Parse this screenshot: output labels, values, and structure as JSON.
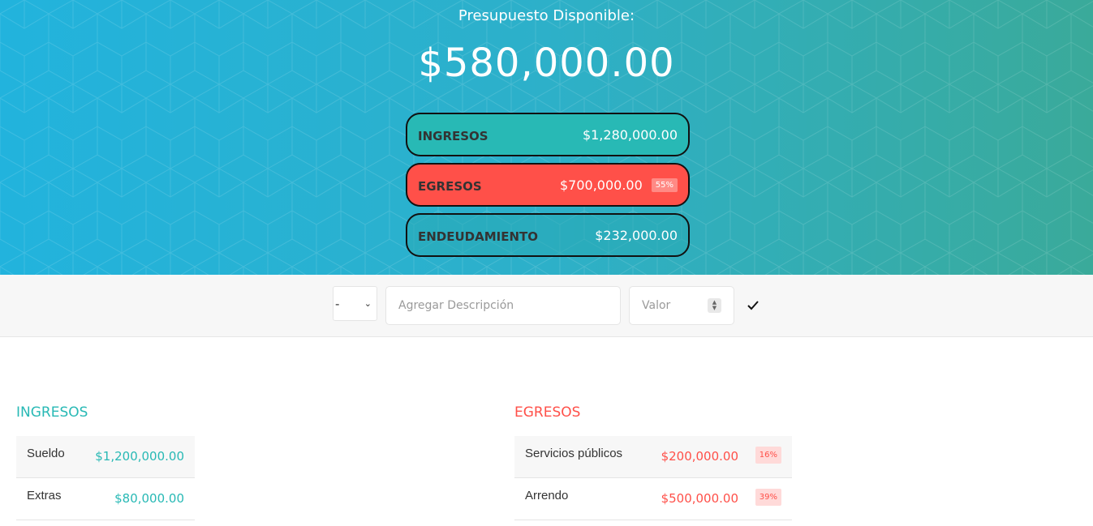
{
  "header": {
    "title": "Presupuesto Disponible:",
    "available": "$580,000.00"
  },
  "summary": {
    "ingresos": {
      "label": "INGRESOS",
      "value": "$1,280,000.00"
    },
    "egresos": {
      "label": "EGRESOS",
      "value": "$700,000.00",
      "percent": "55%"
    },
    "endeudamiento": {
      "label": "ENDEUDAMIENTO",
      "value": "$232,000.00"
    }
  },
  "add_form": {
    "type_selected": "-",
    "description_placeholder": "Agregar Descripción",
    "value_placeholder": "Valor",
    "submit_icon": "check-icon"
  },
  "ingresos": {
    "title": "INGRESOS",
    "items": [
      {
        "description": "Sueldo",
        "value": "$1,200,000.00"
      },
      {
        "description": "Extras",
        "value": "$80,000.00"
      }
    ]
  },
  "egresos": {
    "title": "EGRESOS",
    "items": [
      {
        "description": "Servicios públicos",
        "value": "$200,000.00",
        "percent": "16%"
      },
      {
        "description": "Arrendo",
        "value": "$500,000.00",
        "percent": "39%"
      }
    ]
  },
  "colors": {
    "income": "#28b9b5",
    "expense": "#ff5049",
    "header_gradient_start": "#22b3dd",
    "header_gradient_end": "#3aaa9a"
  }
}
